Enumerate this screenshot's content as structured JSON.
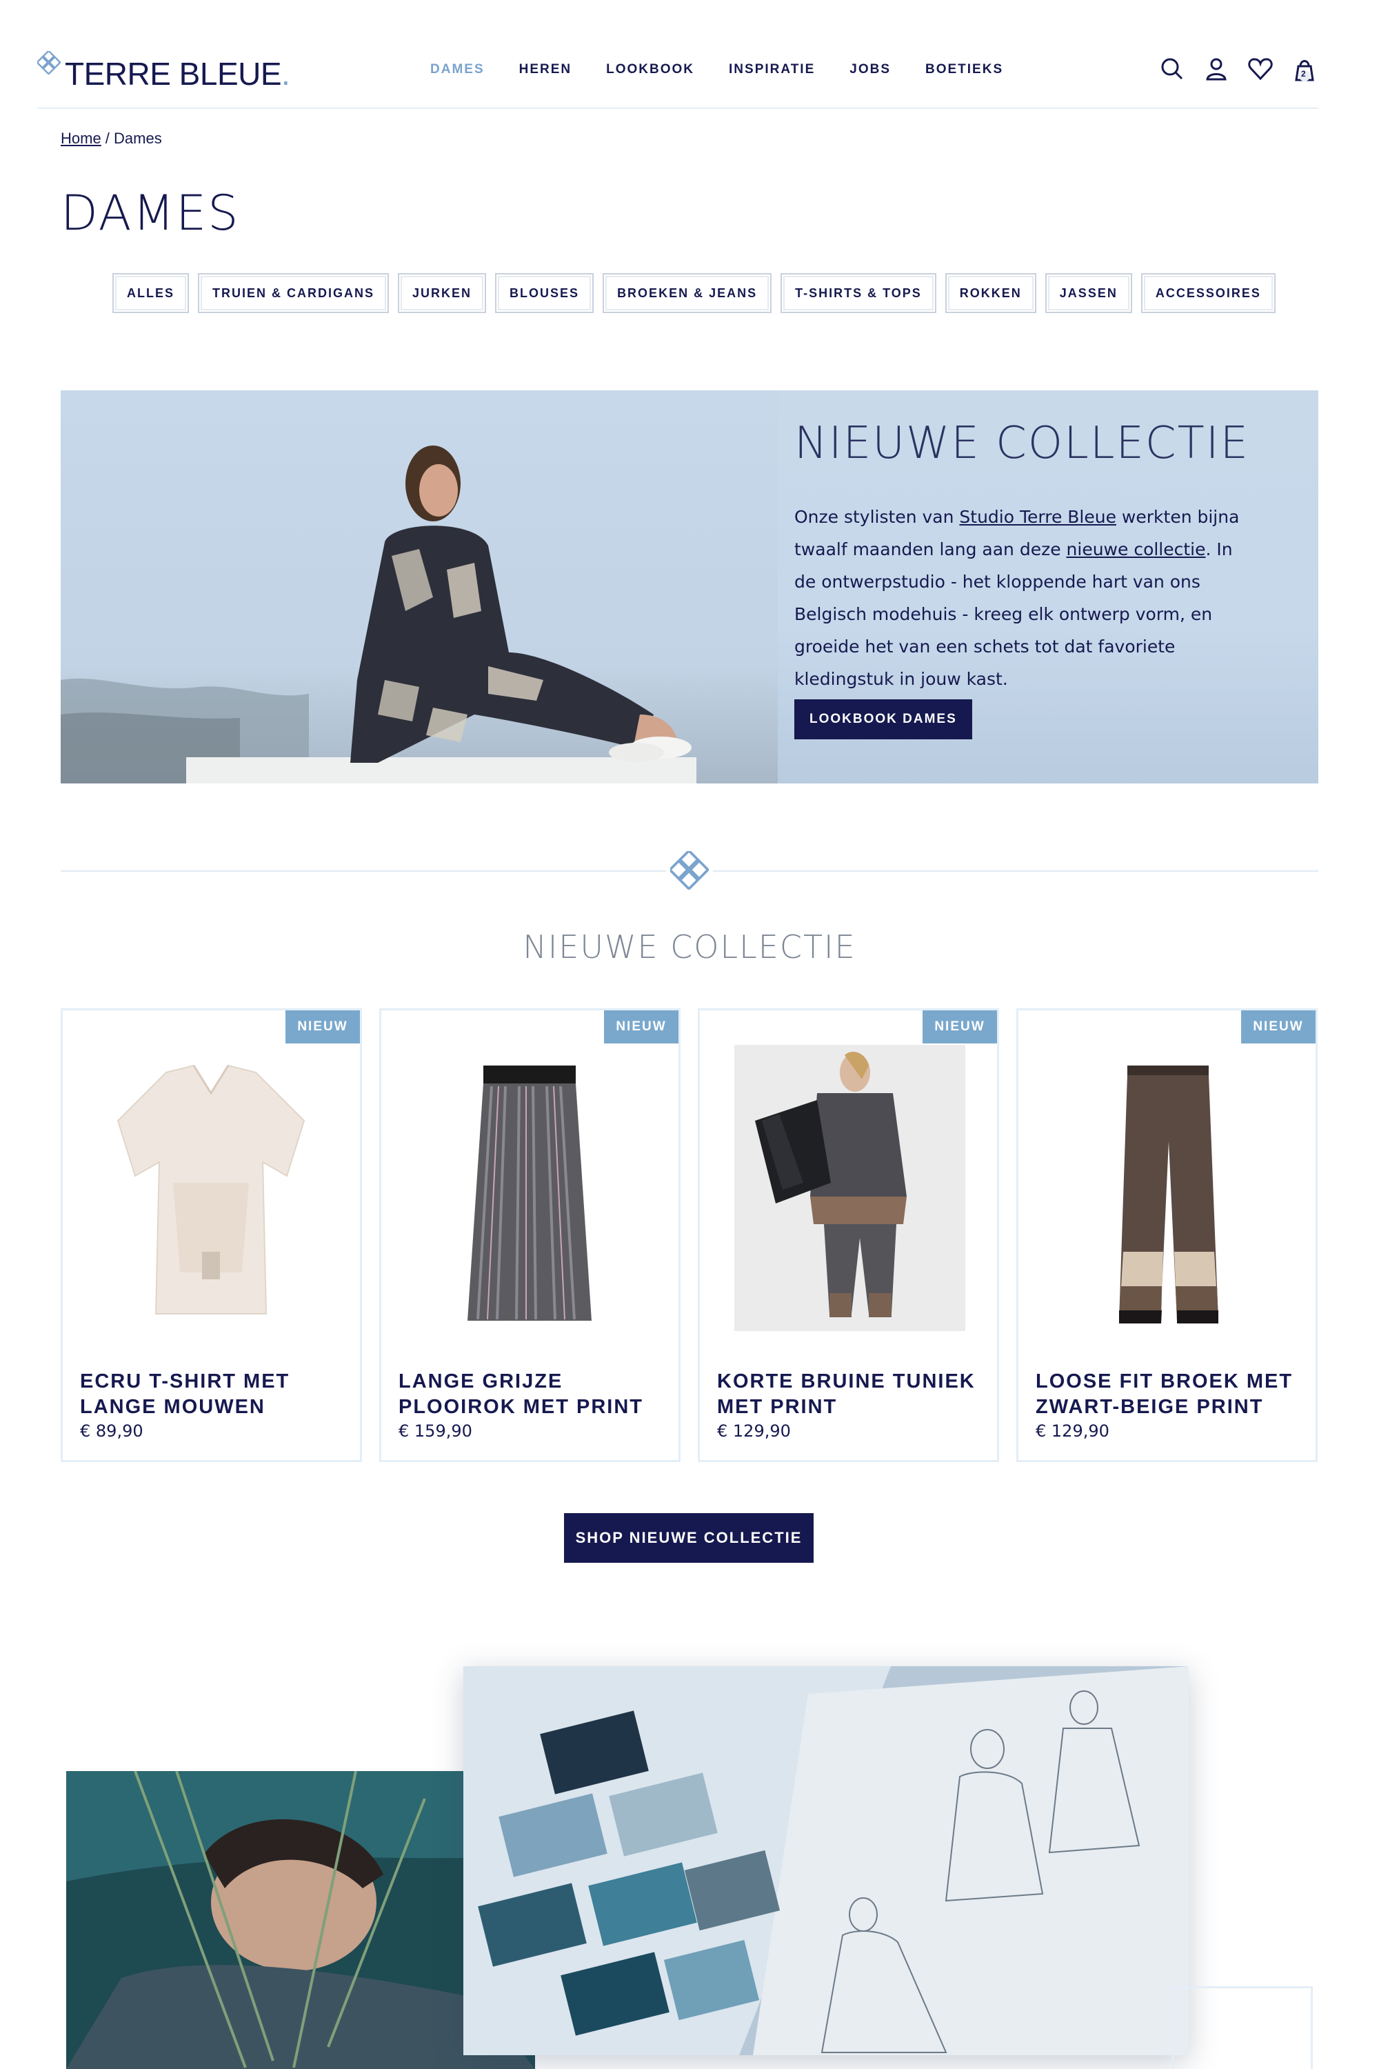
{
  "header": {
    "logo_text": "TERRE BLEUE",
    "logo_dot": ".",
    "nav": [
      "DAMES",
      "HEREN",
      "LOOKBOOK",
      "INSPIRATIE",
      "JOBS",
      "BOETIEKS"
    ],
    "cart_count": "2",
    "icons": [
      "search-icon",
      "user-icon",
      "heart-icon",
      "bag-icon"
    ]
  },
  "breadcrumb": {
    "home": "Home",
    "separator": " / ",
    "current": "Dames"
  },
  "page_title": "DAMES",
  "filters": [
    "ALLES",
    "TRUIEN & CARDIGANS",
    "JURKEN",
    "BLOUSES",
    "BROEKEN & JEANS",
    "T-SHIRTS & TOPS",
    "ROKKEN",
    "JASSEN",
    "ACCESSOIRES"
  ],
  "hero": {
    "title": "NIEUWE COLLECTIE",
    "text_1": "Onze stylisten van ",
    "link_1": "Studio Terre Bleue",
    "text_2": " werkten bijna twaalf maanden lang aan deze ",
    "link_2": "nieuwe collectie",
    "text_3": ". In de ontwerpstudio - het kloppende hart van ons Belgisch modehuis - kreeg elk ontwerp vorm, en groeide het van een schets tot dat favoriete kledingstuk in jouw kast.",
    "button": "LOOKBOOK DAMES"
  },
  "section_title": "NIEUWE COLLECTIE",
  "products": [
    {
      "badge": "NIEUW",
      "name": "ECRU T-SHIRT MET LANGE MOUWEN",
      "price": "€ 89,90"
    },
    {
      "badge": "NIEUW",
      "name": "LANGE GRIJZE PLOOIROK MET PRINT",
      "price": "€ 159,90"
    },
    {
      "badge": "NIEUW",
      "name": "KORTE BRUINE TUNIEK MET PRINT",
      "price": "€ 129,90"
    },
    {
      "badge": "NIEUW",
      "name": "LOOSE FIT BROEK MET ZWART-BEIGE PRINT",
      "price": "€ 129,90"
    }
  ],
  "shop_button": "SHOP NIEUWE COLLECTIE",
  "colors": {
    "navy": "#16194f",
    "accent": "#7aa8cd",
    "hero_bg": "#c8d9ea"
  }
}
